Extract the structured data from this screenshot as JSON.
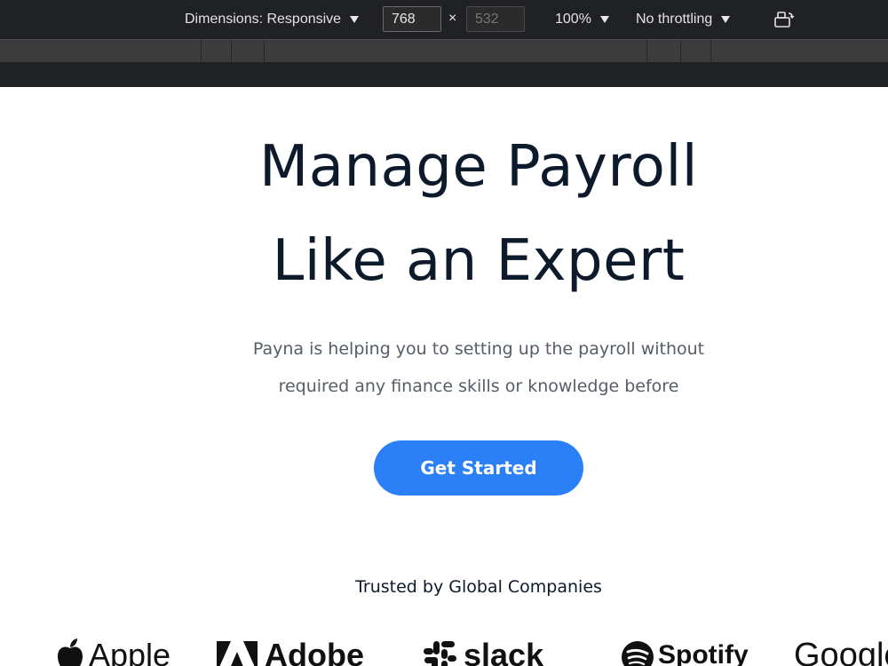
{
  "devtools": {
    "dimensions_label": "Dimensions: Responsive",
    "width_value": "768",
    "height_value": "532",
    "times": "×",
    "zoom_label": "100%",
    "throttling_label": "No throttling",
    "rotate_icon": "rotate-device-icon"
  },
  "hero": {
    "title_line1": "Manage Payroll",
    "title_line2": "Like an Expert",
    "subtitle_line1": "Payna is helping you to setting up the payroll without",
    "subtitle_line2": "required any finance skills or knowledge before",
    "cta_label": "Get Started"
  },
  "trusted": {
    "heading": "Trusted by Global Companies",
    "logos": [
      {
        "name": "Apple",
        "icon": "apple-icon"
      },
      {
        "name": "Adobe",
        "icon": "adobe-icon"
      },
      {
        "name": "slack",
        "icon": "slack-icon"
      },
      {
        "name": "Spotify",
        "icon": "spotify-icon"
      },
      {
        "name": "Google",
        "icon": ""
      }
    ]
  },
  "colors": {
    "toolbar_bg": "#202124",
    "ruler_bg": "#3c3c3c",
    "title": "#0d1a2b",
    "subtitle": "#555d68",
    "cta_bg": "#2b7ff7"
  }
}
